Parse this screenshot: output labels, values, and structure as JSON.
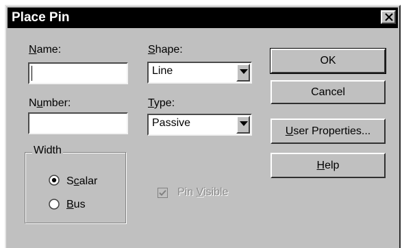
{
  "window": {
    "title": "Place Pin",
    "close_icon": "close-icon"
  },
  "fields": {
    "name_label": "Name:",
    "name_value": "",
    "number_label": "Number:",
    "number_value": "",
    "shape_label": "Shape:",
    "shape_value": "Line",
    "type_label": "Type:",
    "type_value": "Passive"
  },
  "width_group": {
    "legend": "Width",
    "options": [
      {
        "label": "Scalar",
        "selected": true
      },
      {
        "label": "Bus",
        "selected": false
      }
    ]
  },
  "pin_visible": {
    "label": "Pin Visible",
    "checked": true,
    "enabled": false
  },
  "buttons": {
    "ok": "OK",
    "cancel": "Cancel",
    "user_properties": "User Properties...",
    "help": "Help"
  },
  "colors": {
    "titlebar": "#000000",
    "dialog_face": "#c0c0c0"
  }
}
